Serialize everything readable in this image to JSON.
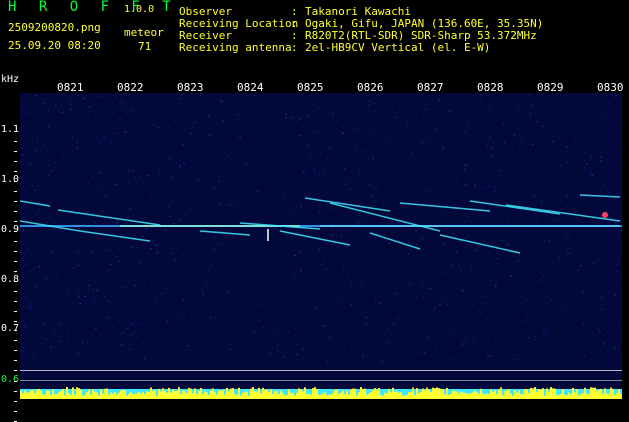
{
  "app": {
    "title": "H R O F F T",
    "version": "1.0.0"
  },
  "capture": {
    "filename": "2509200820.png",
    "timestamp": "25.09.20 08:20",
    "meteor_label": "meteor",
    "meteor_count": "71"
  },
  "station": [
    {
      "key": "Observer",
      "value": "Takanori Kawachi"
    },
    {
      "key": "Receiving Location",
      "value": "Ogaki, Gifu, JAPAN (136.60E, 35.35N)"
    },
    {
      "key": "Receiver",
      "value": "R820T2(RTL-SDR) SDR-Sharp 53.372MHz"
    },
    {
      "key": "Receiving antenna",
      "value": "2el-HB9CV Vertical (el. E-W)"
    }
  ],
  "axis": {
    "unit": "kHz",
    "time_ticks": [
      "0821",
      "0822",
      "0823",
      "0824",
      "0825",
      "0826",
      "0827",
      "0828",
      "0829",
      "0830"
    ],
    "freq_ticks": [
      "1.1",
      "1.0",
      "0.9",
      "0.8",
      "0.7",
      "0.6"
    ]
  },
  "colors": {
    "label_green": "#00ff3c",
    "label_yellow": "#ffff30",
    "spectrum_bg": "#03083a",
    "signal_cyan": "#40e8ff",
    "signal_yellow": "#ffff30",
    "baseline_white": "#ffffff"
  }
}
